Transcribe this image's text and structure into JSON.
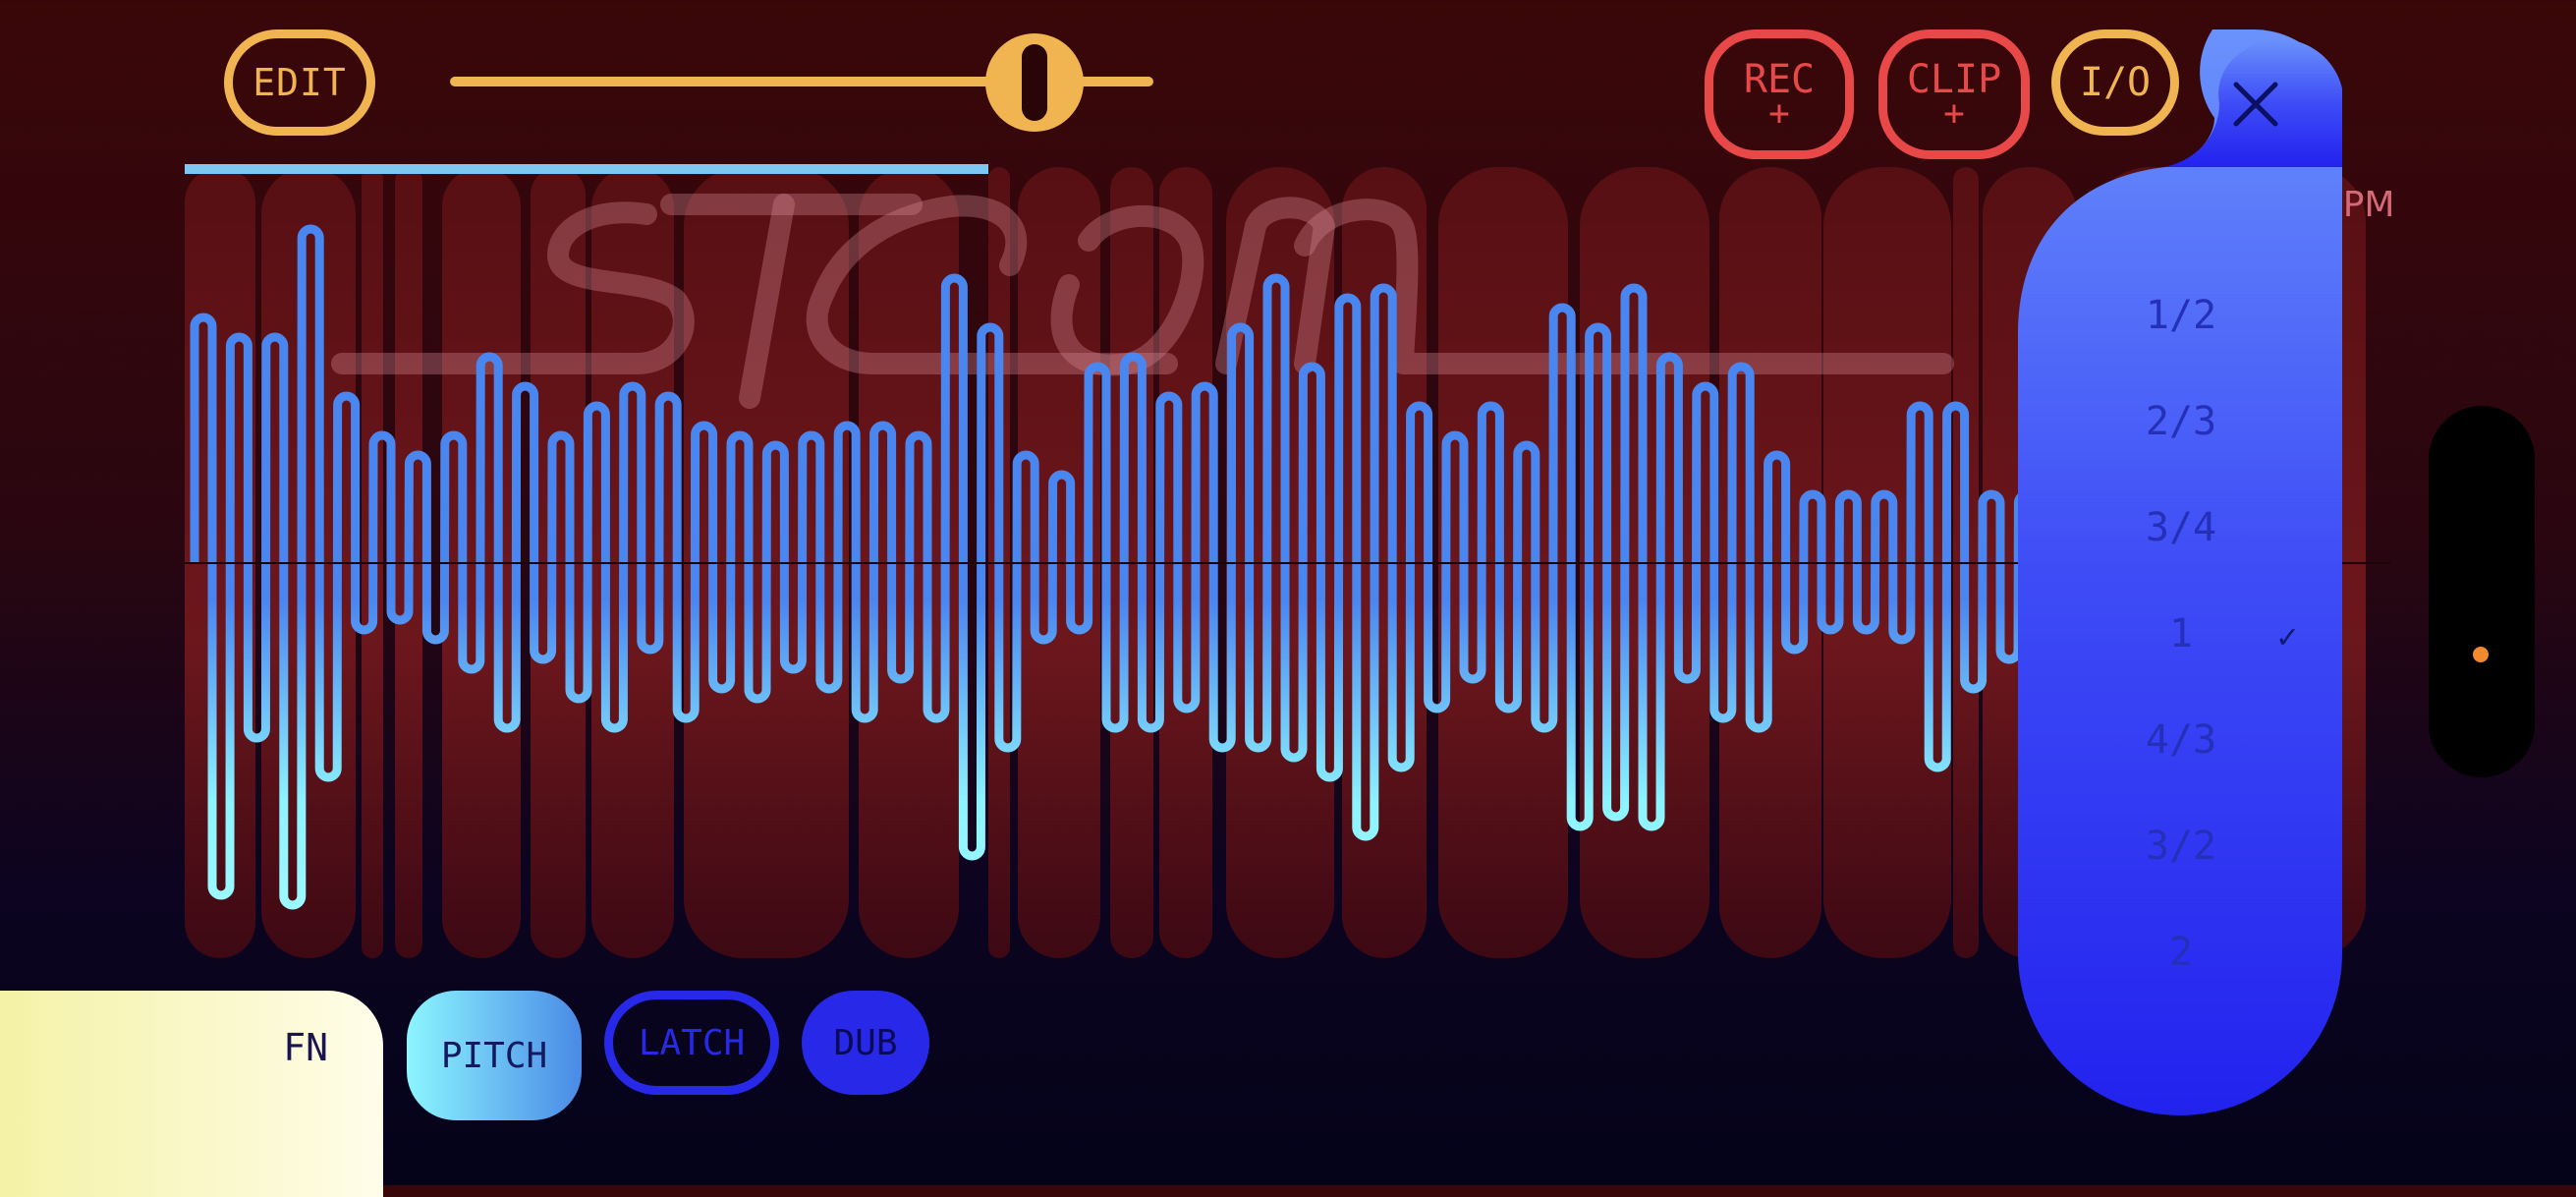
{
  "toolbar": {
    "edit_label": "EDIT",
    "rec_label": "REC",
    "rec_sub": "+",
    "clip_label": "CLIP",
    "clip_sub": "+",
    "io_label": "I/O"
  },
  "speed_slider": {
    "value_fraction": 0.84
  },
  "playback_progress": 0.39,
  "logo_text": "stream",
  "bpm_label": "BPM",
  "rate_dropdown": {
    "options": [
      "1/2",
      "2/3",
      "3/4",
      "1",
      "4/3",
      "3/2",
      "2"
    ],
    "selected": "1",
    "check_glyph": "✓"
  },
  "bottom_buttons": {
    "fn_label": "FN",
    "pitch_label": "PITCH",
    "latch_label": "LATCH",
    "dub_label": "DUB"
  },
  "colors": {
    "accent_gold": "#f0b450",
    "record_red": "#e84848",
    "wave_blue": "#4a86f0",
    "wave_cyan": "#8cf4ff",
    "progress_blue": "#7cc8f2",
    "dropdown_blue": "#2a2af0",
    "pitch_cyan": "#8cf6ff",
    "latch_blue": "#2828e8",
    "fn_yellow": "#f4f2a6",
    "marker_orange": "#f08a2c"
  },
  "icons": {
    "close": "close-icon",
    "check": "check-icon",
    "knob": "slider-knob-icon"
  }
}
